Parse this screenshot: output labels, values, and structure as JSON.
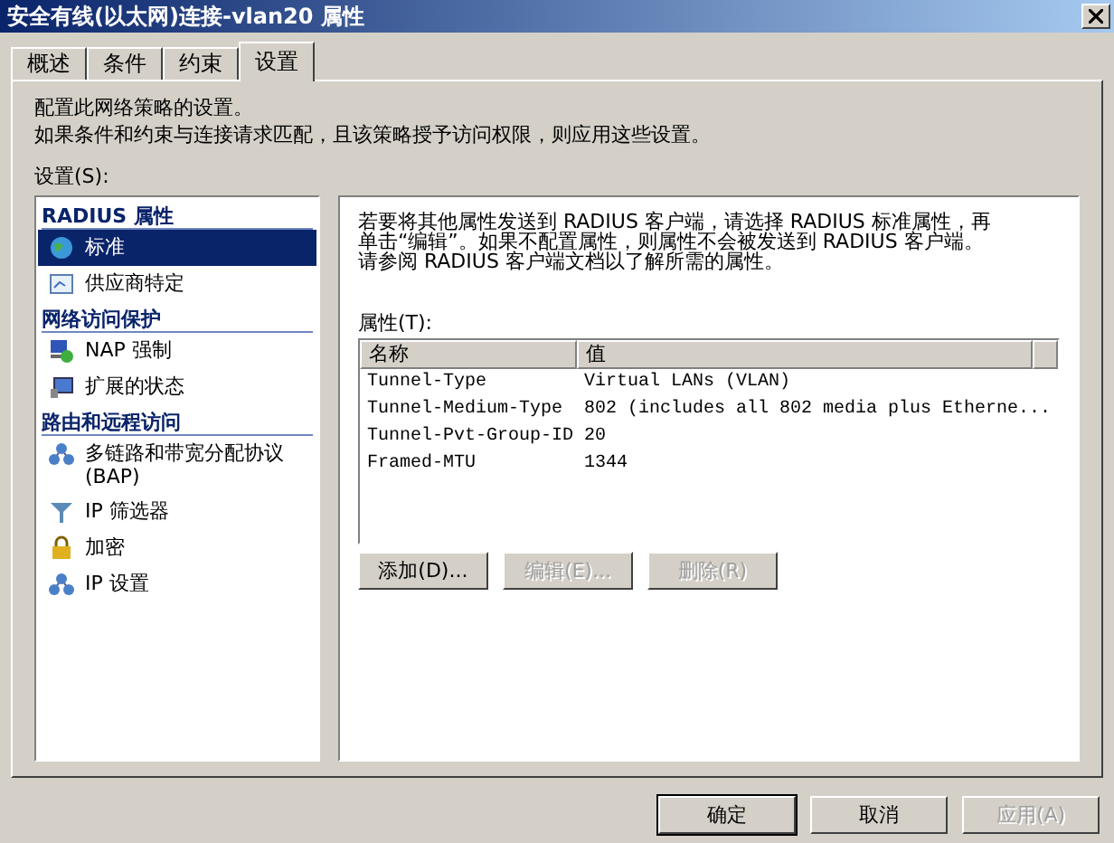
{
  "window": {
    "title": "安全有线(以太网)连接-vlan20 属性"
  },
  "tabs": [
    {
      "label": "概述",
      "selected": false
    },
    {
      "label": "条件",
      "selected": false
    },
    {
      "label": "约束",
      "selected": false
    },
    {
      "label": "设置",
      "selected": true
    }
  ],
  "intro": [
    "配置此网络策略的设置。",
    "如果条件和约束与连接请求匹配，且该策略授予访问权限，则应用这些设置。"
  ],
  "settings_label": "设置(S):",
  "sidebar": [
    {
      "kind": "header",
      "label": "RADIUS 属性"
    },
    {
      "kind": "item",
      "label": "标准",
      "selected": true
    },
    {
      "kind": "item",
      "label": "供应商特定",
      "selected": false
    },
    {
      "kind": "header",
      "label": "网络访问保护"
    },
    {
      "kind": "item",
      "label": "NAP 强制",
      "selected": false
    },
    {
      "kind": "item",
      "label": "扩展的状态",
      "selected": false
    },
    {
      "kind": "header",
      "label": "路由和远程访问"
    },
    {
      "kind": "item",
      "label": "多链路和带宽分配协议 (BAP)",
      "selected": false
    },
    {
      "kind": "item",
      "label": "IP 筛选器",
      "selected": false
    },
    {
      "kind": "item",
      "label": "加密",
      "selected": false
    },
    {
      "kind": "item",
      "label": "IP 设置",
      "selected": false
    }
  ],
  "detail": {
    "description": "若要将其他属性发送到 RADIUS 客户端，请选择 RADIUS 标准属性，再单击“编辑”。如果不配置属性，则属性不会被发送到 RADIUS 客户端。请参阅 RADIUS 客户端文档以了解所需的属性。",
    "attributes_label": "属性(T):",
    "columns": [
      "名称",
      "值"
    ],
    "rows": [
      [
        "Tunnel-Type",
        "Virtual LANs (VLAN)"
      ],
      [
        "Tunnel-Medium-Type",
        "802 (includes all 802 media plus Etherne..."
      ],
      [
        "Tunnel-Pvt-Group-ID",
        "20"
      ],
      [
        "Framed-MTU",
        "1344"
      ]
    ],
    "buttons": [
      {
        "label": "添加(D)...",
        "disabled": false
      },
      {
        "label": "编辑(E)...",
        "disabled": true
      },
      {
        "label": "删除(R)",
        "disabled": true
      }
    ]
  },
  "footer_buttons": [
    {
      "label": "确定",
      "disabled": false,
      "default": true
    },
    {
      "label": "取消",
      "disabled": false,
      "default": false
    },
    {
      "label": "应用(A)",
      "disabled": true,
      "default": false
    }
  ]
}
